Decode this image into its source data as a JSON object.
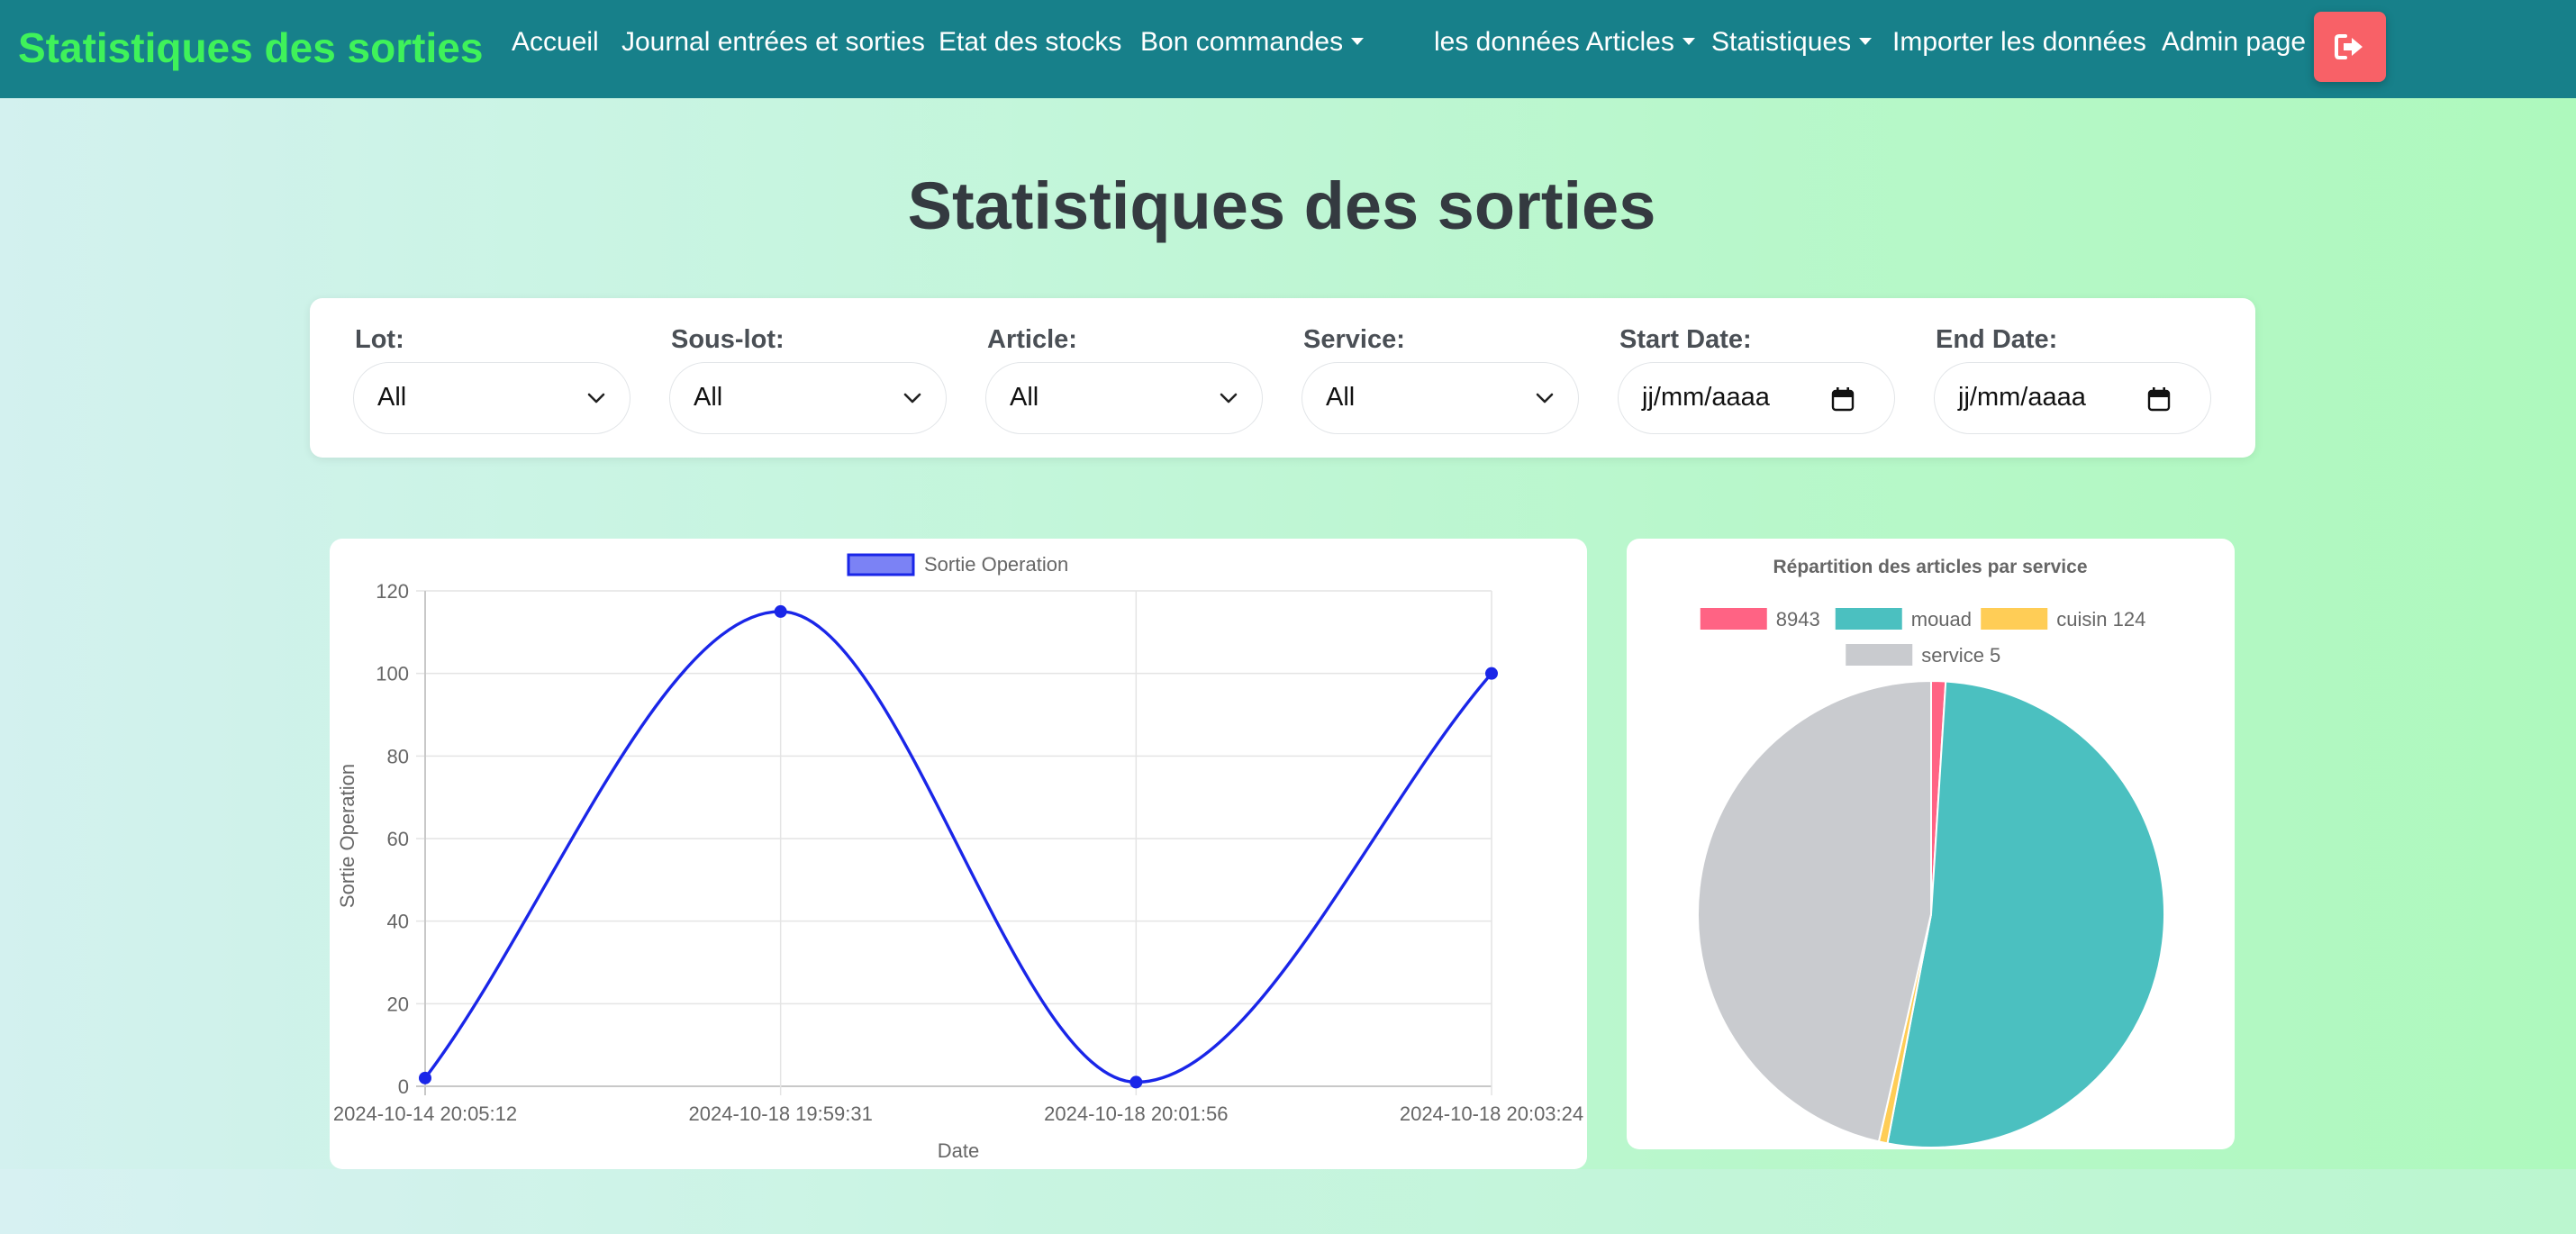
{
  "navbar": {
    "brand": "Statistiques des sorties",
    "items": [
      {
        "label": "Accueil"
      },
      {
        "label": "Journal entrées et sorties"
      },
      {
        "label": "Etat des stocks"
      },
      {
        "label": "Bon commandes",
        "dropdown": true
      },
      {
        "label": "les données Articles",
        "dropdown": true
      },
      {
        "label": "Statistiques",
        "dropdown": true
      },
      {
        "label": "Importer les données"
      },
      {
        "label": "Admin page"
      }
    ],
    "logout_icon": "sign-out-icon"
  },
  "page": {
    "title": "Statistiques des sorties"
  },
  "filters": [
    {
      "label": "Lot:",
      "value": "All",
      "type": "select"
    },
    {
      "label": "Sous-lot:",
      "value": "All",
      "type": "select"
    },
    {
      "label": "Article:",
      "value": "All",
      "type": "select"
    },
    {
      "label": "Service:",
      "value": "All",
      "type": "select"
    },
    {
      "label": "Start Date:",
      "value": "jj/mm/aaaa",
      "type": "date"
    },
    {
      "label": "End Date:",
      "value": "jj/mm/aaaa",
      "type": "date"
    }
  ],
  "colors": {
    "navbar": "#17808a",
    "brand": "#3ff25a",
    "logout": "#f86167",
    "line": "#1a26e8"
  },
  "chart_data": [
    {
      "type": "line",
      "title": "",
      "legend": {
        "position": "top",
        "entries": [
          "Sortie Operation"
        ]
      },
      "xlabel": "Date",
      "ylabel": "Sortie Operation",
      "categories": [
        "2024-10-14 20:05:12",
        "2024-10-18 19:59:31",
        "2024-10-18 20:01:56",
        "2024-10-18 20:03:24"
      ],
      "series": [
        {
          "name": "Sortie Operation",
          "values": [
            2,
            115,
            1,
            100
          ],
          "color": "#1a26e8"
        }
      ],
      "ylim": [
        0,
        120
      ],
      "yticks": [
        0,
        20,
        40,
        60,
        80,
        100,
        120
      ],
      "grid": true
    },
    {
      "type": "pie",
      "title": "Répartition des articles par service",
      "legend": {
        "position": "top"
      },
      "slices": [
        {
          "label": "8943",
          "value": 1,
          "color": "#ff6384"
        },
        {
          "label": "mouad",
          "value": 52,
          "color": "#4bc0c0"
        },
        {
          "label": "cuisin 124",
          "value": 0.6,
          "color": "#ffcd56"
        },
        {
          "label": "service 5",
          "value": 46.4,
          "color": "#c9cbcf"
        }
      ]
    }
  ]
}
